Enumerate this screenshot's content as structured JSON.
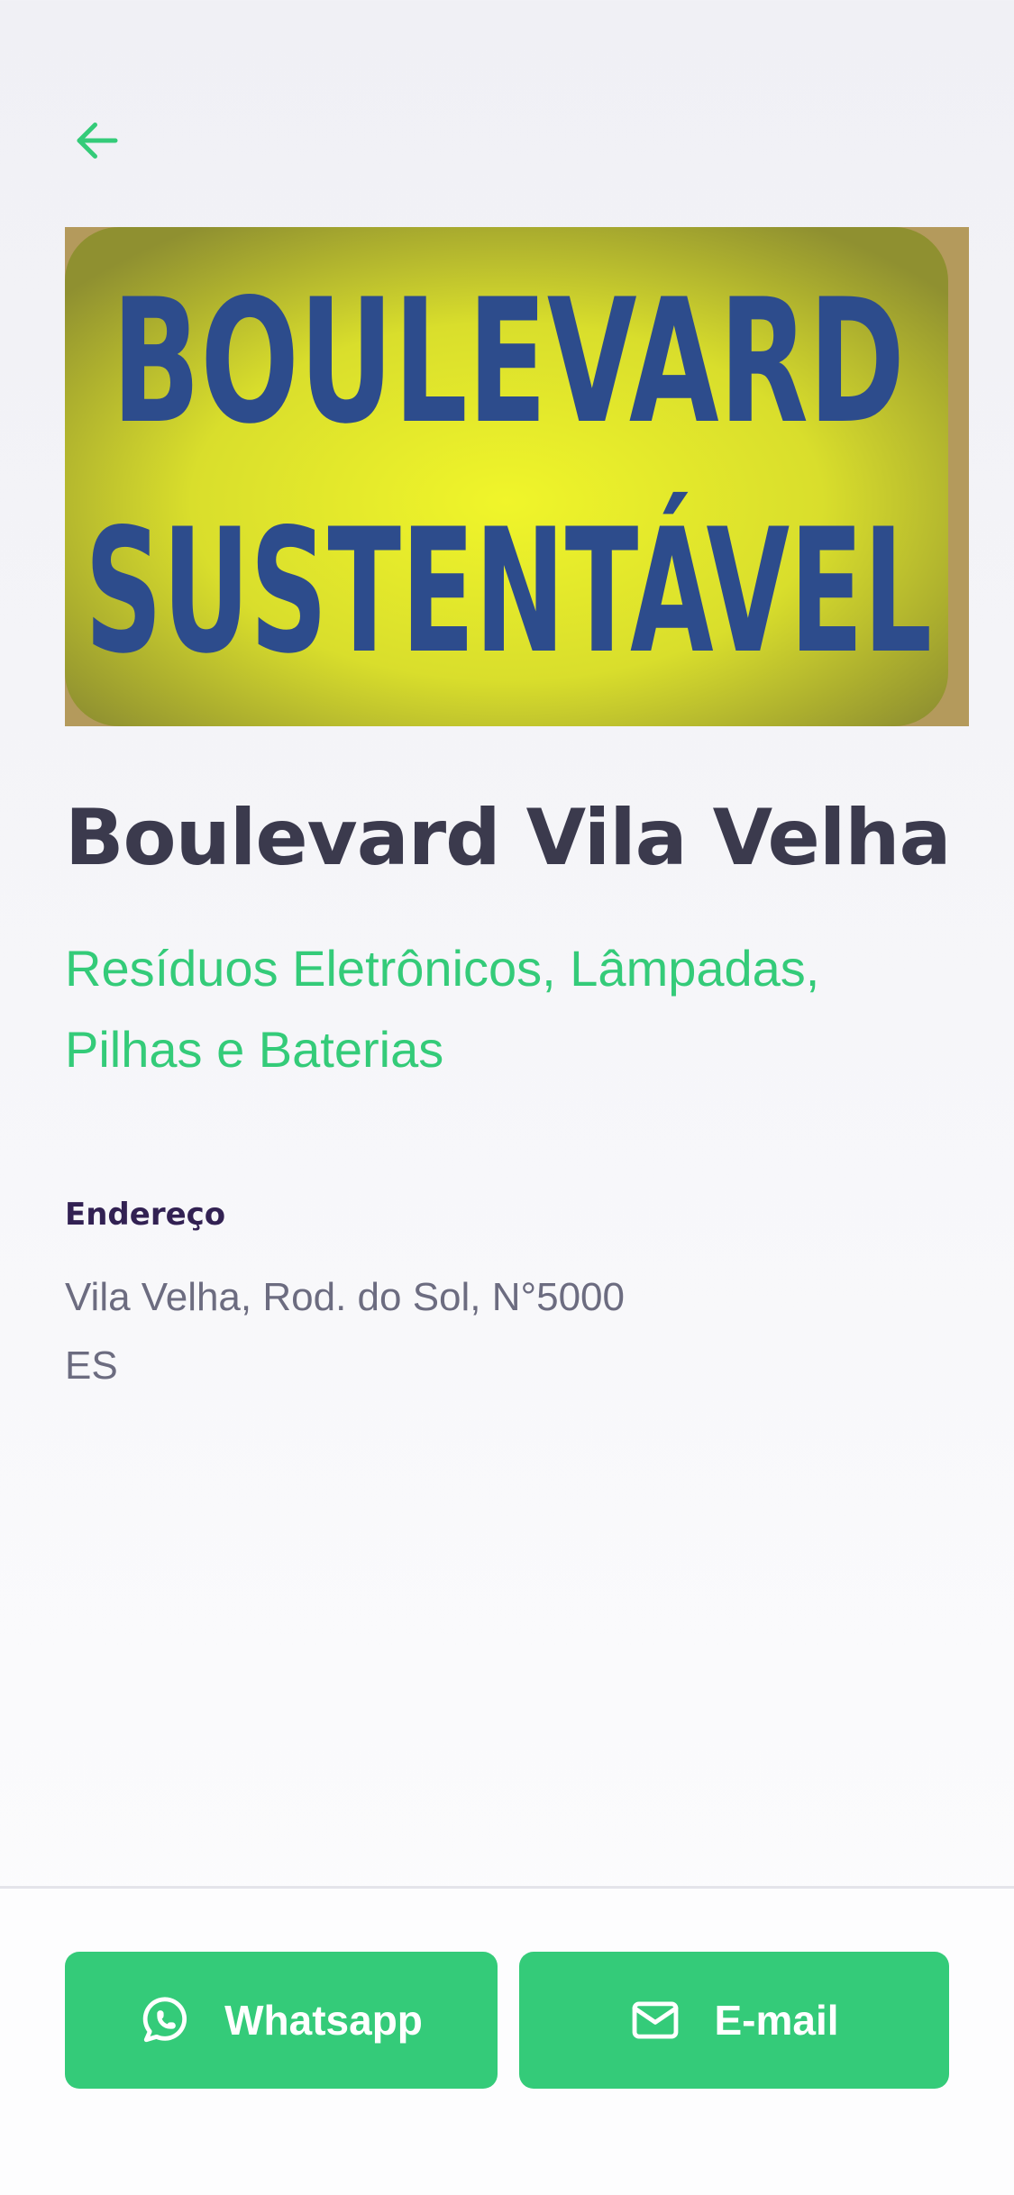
{
  "header": {
    "back_icon": "arrow-left-icon",
    "accent_color": "#34CB79"
  },
  "hero_image": {
    "line1": "BOULEVARD",
    "line2": "SUSTENTÁVEL"
  },
  "place": {
    "name": "Boulevard Vila Velha",
    "items": "Resíduos Eletrônicos, Lâmpadas, Pilhas e Baterias"
  },
  "address": {
    "title": "Endereço",
    "street": "Vila Velha, Rod. do Sol, N°5000",
    "state": "ES"
  },
  "footer": {
    "whatsapp": {
      "label": "Whatsapp",
      "icon": "whatsapp-icon"
    },
    "email": {
      "label": "E-mail",
      "icon": "mail-icon"
    },
    "button_color": "#34CB79"
  }
}
